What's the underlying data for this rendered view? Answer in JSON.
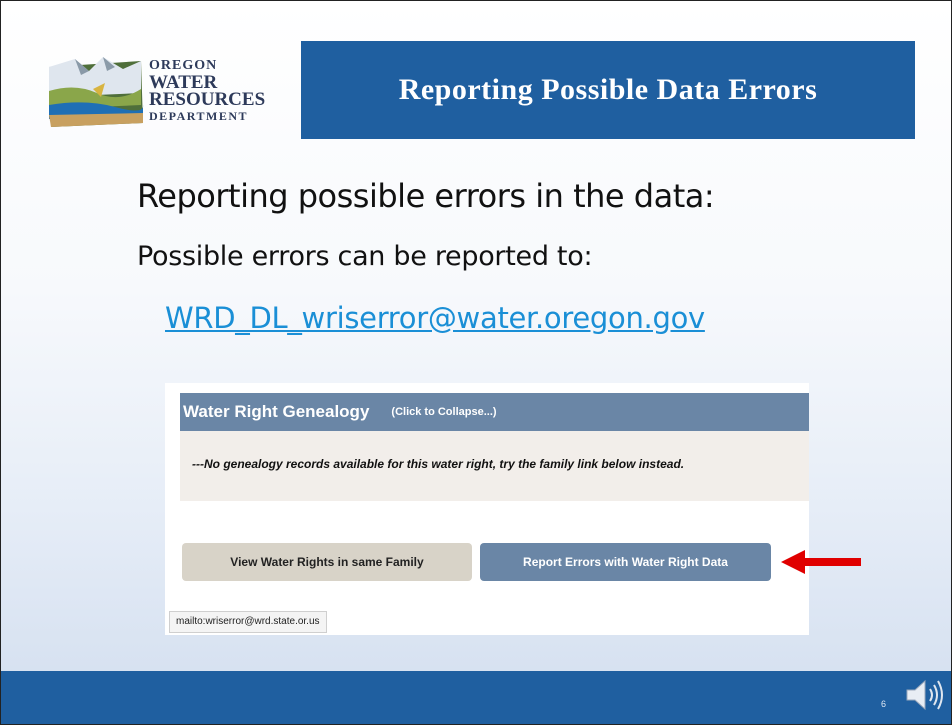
{
  "logo": {
    "line1": "OREGON",
    "line2": "WATER",
    "line3": "RESOURCES",
    "line4": "DEPARTMENT"
  },
  "slide": {
    "title": "Reporting Possible Data Errors",
    "heading": "Reporting possible errors in the data:",
    "subheading": "Possible errors can be reported to:",
    "email": "WRD_DL_wriserror@water.oregon.gov",
    "page_number": "6"
  },
  "screenshot": {
    "section_title": "Water Right Genealogy",
    "collapse_label": "(Click to Collapse...)",
    "message": "---No genealogy records available for this water right, try the family link below instead.",
    "family_button": "View Water Rights in same Family",
    "report_button": "Report Errors with Water Right Data",
    "status_url": "mailto:wriserror@wrd.state.or.us"
  },
  "colors": {
    "banner": "#1f5fa0",
    "link": "#1a8fd6",
    "panel_header": "#6a86a6",
    "arrow": "#e00000"
  },
  "icons": [
    "logo-image",
    "red-arrow-icon",
    "speaker-icon"
  ]
}
